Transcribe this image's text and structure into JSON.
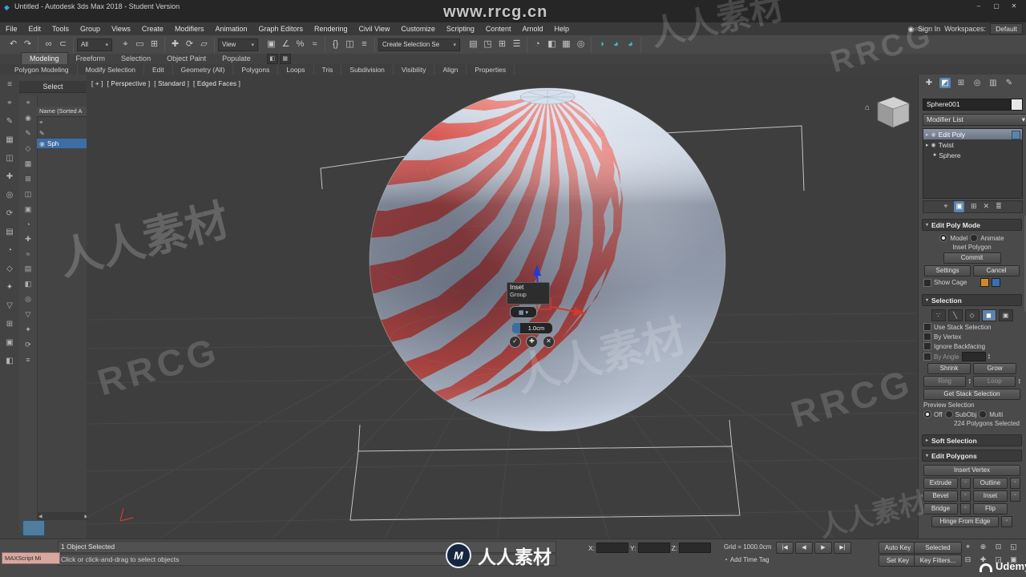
{
  "ui": {
    "chevron_down": "▾",
    "chevron_right": "▸",
    "spin_up": "▴",
    "spin_down": "▾"
  },
  "titlebar": {
    "title": "Untitled - Autodesk 3ds Max 2018 - Student Version",
    "logo_icon": "◆",
    "minimize": "–",
    "maximize": "▢",
    "close": "✕"
  },
  "menubar": {
    "items": [
      "File",
      "Edit",
      "Tools",
      "Group",
      "Views",
      "Create",
      "Modifiers",
      "Animation",
      "Graph Editors",
      "Rendering",
      "Civil View",
      "Customize",
      "Scripting",
      "Content",
      "Arnold",
      "Help"
    ],
    "user_icon": "◉",
    "sign_in": "Sign In",
    "workspaces_label": "Workspaces:",
    "workspace_value": "Default"
  },
  "toolbar": {
    "undo_icons": [
      "↶",
      "↷"
    ],
    "link_icons": [
      "∞",
      "⊂"
    ],
    "filter_value": "All",
    "select_icons": [
      "⌖",
      "▭",
      "⊞"
    ],
    "transform_icons": [
      "✚",
      "⟳",
      "▱"
    ],
    "coord_value": "View",
    "snap_icons": [
      "▣",
      "∠",
      "%",
      "≈"
    ],
    "set_icons": [
      "{}",
      "◫",
      "≡"
    ],
    "selection_set_value": "Create Selection Se",
    "editor_icons": [
      "▤",
      "◳",
      "⊞",
      "☰"
    ],
    "misc_icons": [
      "◔",
      "◧",
      "▦",
      "◎"
    ],
    "render_icons": [
      "◑",
      "◕",
      "◕"
    ]
  },
  "ribbon": {
    "tabs": [
      "Modeling",
      "Freeform",
      "Selection",
      "Object Paint",
      "Populate"
    ],
    "extra_icons": [
      "◧",
      "▦"
    ],
    "sections": [
      "Polygon Modeling",
      "Modify Selection",
      "Edit",
      "Geometry (All)",
      "Polygons",
      "Loops",
      "Tris",
      "Subdivision",
      "Visibility",
      "Align",
      "Properties"
    ]
  },
  "left_toolbar_icons": [
    "≡",
    "⌖",
    "✎",
    "▦",
    "◫",
    "✚",
    "◎",
    "⟳",
    "▤",
    "◔",
    "◇",
    "✦",
    "▽",
    "⊞",
    "▣",
    "◧"
  ],
  "scene_explorer": {
    "title": "Select",
    "column_header": "Name (Sorted A",
    "strip_icons": [
      "⌖",
      "◉",
      "✎",
      "◇",
      "▦",
      "⊞",
      "◫",
      "▣",
      "◔",
      "✚",
      "≈",
      "▤",
      "◧",
      "◎",
      "▽",
      "✦",
      "⟳",
      "≡"
    ],
    "rows": [
      {
        "icon": "⌖",
        "label": ""
      },
      {
        "icon": "✎",
        "label": ""
      },
      {
        "icon": "◉",
        "label": "Sph"
      }
    ],
    "scroll_left": "◀",
    "scroll_right": "▶"
  },
  "viewport": {
    "labels": {
      "plus": "[ + ]",
      "pov": "[ Perspective ]",
      "style": "[ Standard ]",
      "shading": "[ Edged Faces ]"
    },
    "sphere": {
      "base_color": "#c7d2e2",
      "stripe_color": "#e0544c"
    },
    "caddy": {
      "tool": "Inset",
      "mode": "Group",
      "amount": "1.0cm",
      "mode_icon": "▦",
      "ok": "✓",
      "apply": "✚",
      "cancel": "✕"
    }
  },
  "command_panel": {
    "tabs": [
      "✚",
      "◩",
      "⊞",
      "◎",
      "▥",
      "✎"
    ],
    "object_name": "Sphere001",
    "modifier_list_label": "Modifier List",
    "stack": {
      "rows": [
        {
          "arrow": "▸",
          "bulb": "◉",
          "label": "Edit Poly"
        },
        {
          "arrow": "▸",
          "bulb": "◉",
          "label": "Twist"
        },
        {
          "arrow": "",
          "bulb": "●",
          "label": "Sphere"
        }
      ]
    },
    "stack_tools": [
      "⌖",
      "▣",
      "⊞",
      "✕",
      "≣"
    ],
    "edit_poly_mode": {
      "title": "Edit Poly Mode",
      "model": "Model",
      "animate": "Animate",
      "operation": "Inset Polygon",
      "commit": "Commit",
      "settings": "Settings",
      "cancel": "Cancel",
      "show_cage": "Show Cage",
      "cage_colors": [
        "#d0892a",
        "#3a6fb0"
      ]
    },
    "selection": {
      "title": "Selection",
      "subobj_icons": [
        "∵",
        "╲",
        "◇",
        "◼",
        "▣"
      ],
      "use_stack": "Use Stack Selection",
      "by_vertex": "By Vertex",
      "ignore_backfacing": "Ignore Backfacing",
      "by_angle": "By Angle",
      "shrink": "Shrink",
      "grow": "Grow",
      "ring": "Ring",
      "loop": "Loop",
      "get_stack": "Get Stack Selection",
      "preview": "Preview Selection",
      "off": "Off",
      "subobj": "SubObj",
      "multi": "Multi",
      "status": "224 Polygons Selected"
    },
    "soft_selection": {
      "title": "Soft Selection"
    },
    "edit_polygons": {
      "title": "Edit Polygons",
      "insert_vertex": "Insert Vertex",
      "extrude": "Extrude",
      "outline": "Outline",
      "bevel": "Bevel",
      "inset": "Inset",
      "bridge": "Bridge",
      "flip": "Flip",
      "hinge": "Hinge From Edge"
    }
  },
  "status_bar": {
    "maxscript": "MAXScript Mi",
    "selected_info": "1 Object Selected",
    "prompt": "Click or click-and-drag to select objects",
    "x": "X:",
    "y": "Y:",
    "z": "Z:",
    "grid": "Grid = 1000.0cm",
    "time_tag_icon": "◔",
    "time_tag": "Add Time Tag",
    "playback": [
      "|◀",
      "◀",
      "▶",
      "▶|"
    ],
    "auto_key": "Auto Key",
    "selected_mode": "Selected",
    "set_key": "Set Key",
    "key_filters": "Key Filters...",
    "nav_icons_top": [
      "⌖",
      "⊕",
      "⊡",
      "◱"
    ],
    "nav_icons_bottom": [
      "⊟",
      "✚",
      "◲",
      "▣"
    ]
  },
  "watermarks": {
    "url": "www.rrcg.cn",
    "brand_cn": "人人素材",
    "brand_en": "RRCG",
    "logo_letter": "M",
    "udemy": "Udemy"
  }
}
